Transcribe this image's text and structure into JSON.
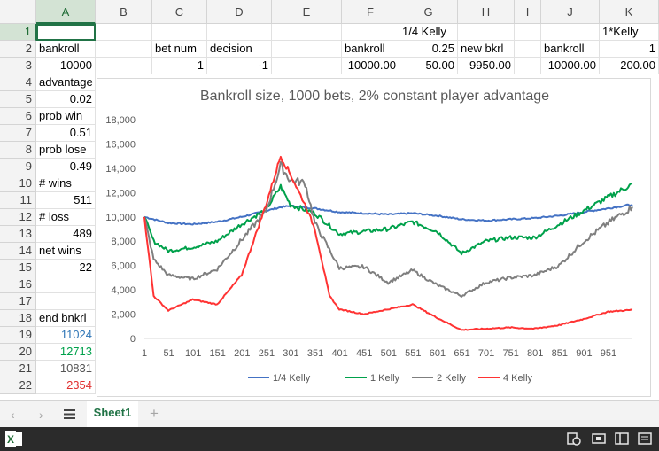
{
  "columns": [
    "A",
    "B",
    "C",
    "D",
    "E",
    "F",
    "G",
    "H",
    "I",
    "J",
    "K"
  ],
  "rows": [
    "1",
    "2",
    "3",
    "4",
    "5",
    "6",
    "7",
    "8",
    "9",
    "10",
    "11",
    "12",
    "13",
    "14",
    "15",
    "16",
    "17",
    "18",
    "19",
    "20",
    "21",
    "22"
  ],
  "cells": {
    "A2": "bankroll",
    "A3": "10000",
    "A4": "advantage",
    "A5": "0.02",
    "A6": "prob  win",
    "A7": "0.51",
    "A8": "prob lose",
    "A9": "0.49",
    "A10": "# wins",
    "A11": "511",
    "A12": "# loss",
    "A13": "489",
    "A14": "net wins",
    "A15": "22",
    "A18": "end bnkrl",
    "A19": "11024",
    "A20": "12713",
    "A21": "10831",
    "A22": "2354",
    "C2": "bet num",
    "C3": "1",
    "D2": "decision",
    "D3": "-1",
    "F2": "bankroll",
    "F3": "10000.00",
    "G1": "1/4 Kelly",
    "G2": "0.25",
    "G3": "50.00",
    "H2": "new bkrl",
    "H3": "9950.00",
    "J2": "bankroll",
    "J3": "10000.00",
    "K1": "1*Kelly",
    "K2": "1",
    "K3": "200.00"
  },
  "end_colors": {
    "A19": "#2e75b6",
    "A20": "#00a14b",
    "A21": "#555555",
    "A22": "#e03030"
  },
  "sheet_tab": "Sheet1",
  "chart_data": {
    "type": "line",
    "title": "Bankroll size, 1000 bets, 2% constant player advantage",
    "xlabel": "",
    "ylabel": "",
    "x_ticks": [
      "1",
      "51",
      "101",
      "151",
      "201",
      "251",
      "301",
      "351",
      "401",
      "451",
      "501",
      "551",
      "601",
      "651",
      "701",
      "751",
      "801",
      "851",
      "901",
      "951"
    ],
    "y_ticks": [
      "0",
      "2,000",
      "4,000",
      "6,000",
      "8,000",
      "10,000",
      "12,000",
      "14,000",
      "16,000",
      "18,000"
    ],
    "ylim": [
      0,
      18000
    ],
    "xlim": [
      1,
      1000
    ],
    "legend_position": "bottom",
    "series": [
      {
        "name": "1/4 Kelly",
        "color": "#4472c4",
        "x": [
          1,
          50,
          100,
          150,
          200,
          250,
          280,
          300,
          350,
          400,
          450,
          500,
          550,
          600,
          650,
          700,
          750,
          800,
          850,
          900,
          950,
          1000
        ],
        "values": [
          10000,
          9500,
          9400,
          9600,
          10000,
          10500,
          10800,
          10900,
          10700,
          10400,
          10300,
          10200,
          10300,
          10100,
          9800,
          9700,
          9800,
          9900,
          10100,
          10400,
          10700,
          11024
        ]
      },
      {
        "name": "1 Kelly",
        "color": "#00a14b",
        "x": [
          1,
          20,
          50,
          100,
          150,
          200,
          250,
          280,
          300,
          350,
          400,
          450,
          500,
          550,
          600,
          650,
          700,
          750,
          800,
          850,
          900,
          950,
          1000
        ],
        "values": [
          10000,
          8000,
          7200,
          7500,
          8000,
          9400,
          10600,
          12500,
          11000,
          10300,
          8600,
          8800,
          9000,
          9600,
          8800,
          7000,
          8000,
          8300,
          8300,
          9400,
          10500,
          11600,
          12713
        ]
      },
      {
        "name": "2 Kelly",
        "color": "#7f7f7f",
        "x": [
          1,
          20,
          50,
          100,
          150,
          200,
          250,
          280,
          300,
          330,
          350,
          400,
          450,
          500,
          550,
          600,
          650,
          700,
          750,
          800,
          850,
          900,
          950,
          1000
        ],
        "values": [
          10000,
          6500,
          5200,
          4900,
          5700,
          8100,
          10500,
          14200,
          13000,
          12800,
          9500,
          5800,
          5900,
          4600,
          5600,
          4400,
          3500,
          4600,
          5000,
          5200,
          6000,
          8000,
          9500,
          10831
        ]
      },
      {
        "name": "4 Kelly",
        "color": "#ff3333",
        "x": [
          1,
          20,
          50,
          100,
          150,
          200,
          250,
          280,
          300,
          330,
          350,
          380,
          400,
          450,
          500,
          550,
          600,
          650,
          700,
          750,
          800,
          850,
          900,
          950,
          1000
        ],
        "values": [
          10000,
          3500,
          2300,
          3200,
          2800,
          5200,
          11000,
          15000,
          13500,
          11000,
          9000,
          3500,
          2400,
          2000,
          2400,
          2800,
          1700,
          700,
          800,
          900,
          800,
          1100,
          1600,
          2200,
          2354
        ]
      }
    ]
  }
}
